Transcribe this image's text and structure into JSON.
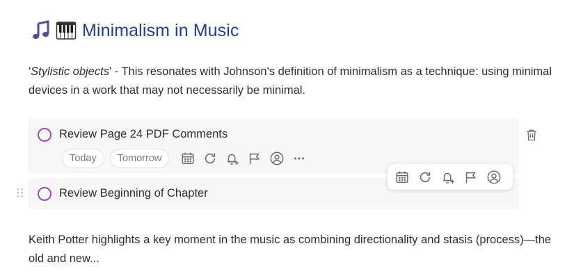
{
  "page": {
    "title": "Minimalism in Music",
    "title_icons": [
      "musical-notes-icon",
      "piano-keys-icon"
    ]
  },
  "paragraph1": {
    "quote_open": "'",
    "italic": "Stylistic objects",
    "quote_close": "'",
    "rest": " - This resonates with Johnson's definition of minimalism as a technique: using minimal devices in a work that may not necessarily be minimal."
  },
  "tasks": [
    {
      "title": "Review Page 24 PDF Comments",
      "chips": [
        "Today",
        "Tomorrow"
      ],
      "actions": [
        "calendar-icon",
        "repeat-icon",
        "reminder-bell-icon",
        "flag-icon",
        "assignee-icon",
        "more-icon"
      ]
    },
    {
      "title": "Review Beginning of Chapter"
    }
  ],
  "floating_toolbar": {
    "actions": [
      "calendar-icon",
      "repeat-icon",
      "reminder-bell-icon",
      "flag-icon",
      "assignee-icon"
    ]
  },
  "paragraph2": {
    "text": "Keith Potter highlights a key moment in the music as combining directionality and stasis (process)—the old and new..."
  },
  "colors": {
    "title": "#23408e",
    "checkbox": "#9b4db1",
    "task_bg": "#f7f7f7",
    "icon": "#6b6b6b"
  }
}
